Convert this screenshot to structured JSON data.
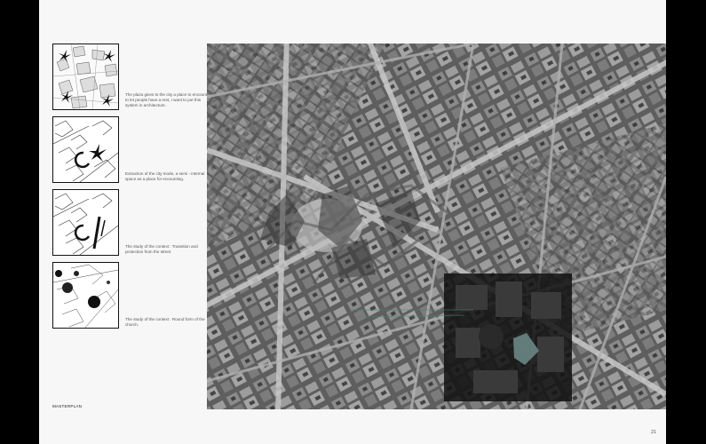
{
  "panels": [
    {
      "caption": "The plaza gives to the city a place to encounter, to let people have a rest, I want to put this system in architecture."
    },
    {
      "caption": "Extraction of the city mode, a semi - internal space as a place for encounting."
    },
    {
      "caption": "The study of the context : Transition and protection from the street."
    },
    {
      "caption": "The study of the context : Round form of the church."
    }
  ],
  "footer": {
    "label": "MASTERPLAN",
    "page_number": "21"
  }
}
